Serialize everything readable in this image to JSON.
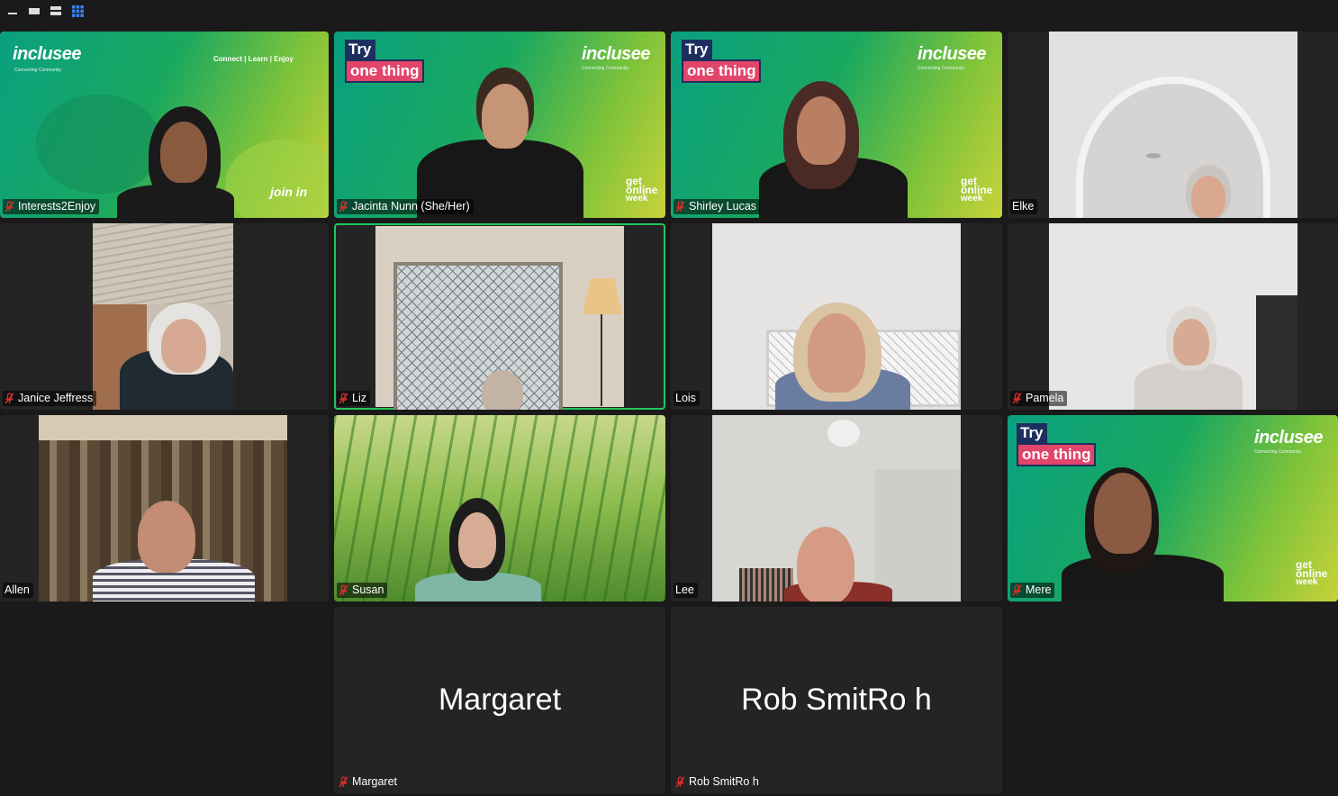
{
  "toolbar": {
    "icons": [
      "minimize-icon",
      "speaker-view-icon",
      "strip-view-icon",
      "gallery-view-icon"
    ]
  },
  "participants": [
    {
      "name": "Interests2Enjoy",
      "muted": true,
      "background": "inclusee-connect"
    },
    {
      "name": "Jacinta Nunn (She/Her)",
      "muted": true,
      "background": "inclusee-try"
    },
    {
      "name": "Shirley Lucas",
      "muted": true,
      "background": "inclusee-try"
    },
    {
      "name": "Elke",
      "muted": false,
      "background": "camera"
    },
    {
      "name": "Janice Jeffress",
      "muted": true,
      "background": "camera"
    },
    {
      "name": "Liz",
      "muted": true,
      "background": "camera",
      "active": true
    },
    {
      "name": "Lois",
      "muted": false,
      "background": "camera"
    },
    {
      "name": "Pamela",
      "muted": true,
      "background": "camera"
    },
    {
      "name": "Allen",
      "muted": false,
      "background": "camera"
    },
    {
      "name": "Susan",
      "muted": true,
      "background": "grass"
    },
    {
      "name": "Lee",
      "muted": false,
      "background": "camera"
    },
    {
      "name": "Mere",
      "muted": true,
      "background": "inclusee-try"
    },
    {
      "name": "Margaret",
      "muted": true,
      "video_off": true,
      "display_name": "Margaret"
    },
    {
      "name": "Rob SmitRo h",
      "muted": true,
      "video_off": true,
      "display_name": "Rob SmitRo h"
    }
  ],
  "branding": {
    "logo": "inclusee",
    "logo_sub": "Connecting Community",
    "tagline": "Connect | Learn | Enjoy",
    "try": "Try",
    "one_thing": "one thing",
    "join_in": "join in",
    "get": "get",
    "online": "online",
    "week": "week"
  },
  "colors": {
    "background": "#1a1a1a",
    "tile": "#242424",
    "active_border": "#22c55e",
    "muted_icon": "#e02b2b",
    "brand_navy": "#1d2f5e",
    "brand_pink": "#e2456a"
  }
}
